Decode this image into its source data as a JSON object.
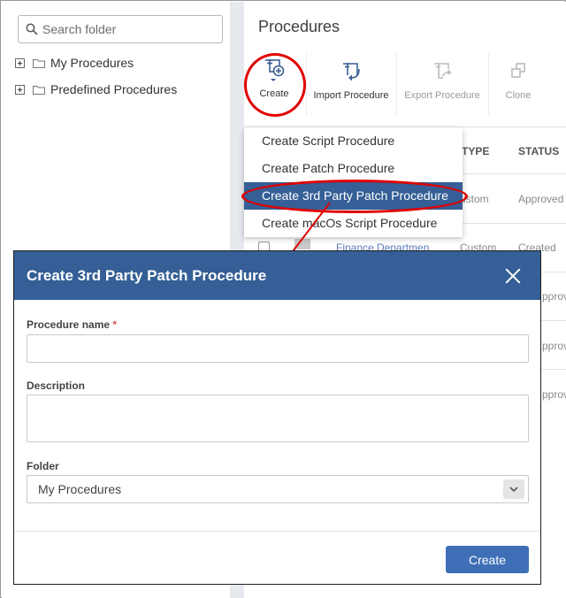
{
  "sidebar": {
    "search_placeholder": "Search folder",
    "tree": [
      {
        "label": "My Procedures"
      },
      {
        "label": "Predefined Procedures"
      }
    ]
  },
  "main": {
    "title": "Procedures",
    "toolbar": {
      "create": "Create",
      "import": "Import Procedure",
      "export": "Export Procedure",
      "clone": "Clone"
    },
    "table": {
      "col_type": "TYPE",
      "col_status": "STATUS",
      "rows": [
        {
          "name": "",
          "type": "ustom",
          "status": "Approved"
        },
        {
          "name": "Finance Departmen",
          "type": "Custom",
          "status": "Created"
        },
        {
          "status": "pproved"
        },
        {
          "status": "pproved"
        },
        {
          "status": "pproved"
        }
      ]
    }
  },
  "dropdown": {
    "items": [
      "Create Script Procedure",
      "Create Patch Procedure",
      "Create 3rd Party Patch Procedure",
      "Create macOs Script Procedure"
    ]
  },
  "modal": {
    "title": "Create 3rd Party Patch Procedure",
    "name_label": "Procedure name",
    "required_mark": "*",
    "name_value": "",
    "description_label": "Description",
    "description_value": "",
    "folder_label": "Folder",
    "folder_value": "My Procedures",
    "create_button": "Create"
  },
  "colors": {
    "header_blue": "#355f96",
    "button_blue": "#3e6fb6",
    "annotation_red": "#e00000"
  }
}
